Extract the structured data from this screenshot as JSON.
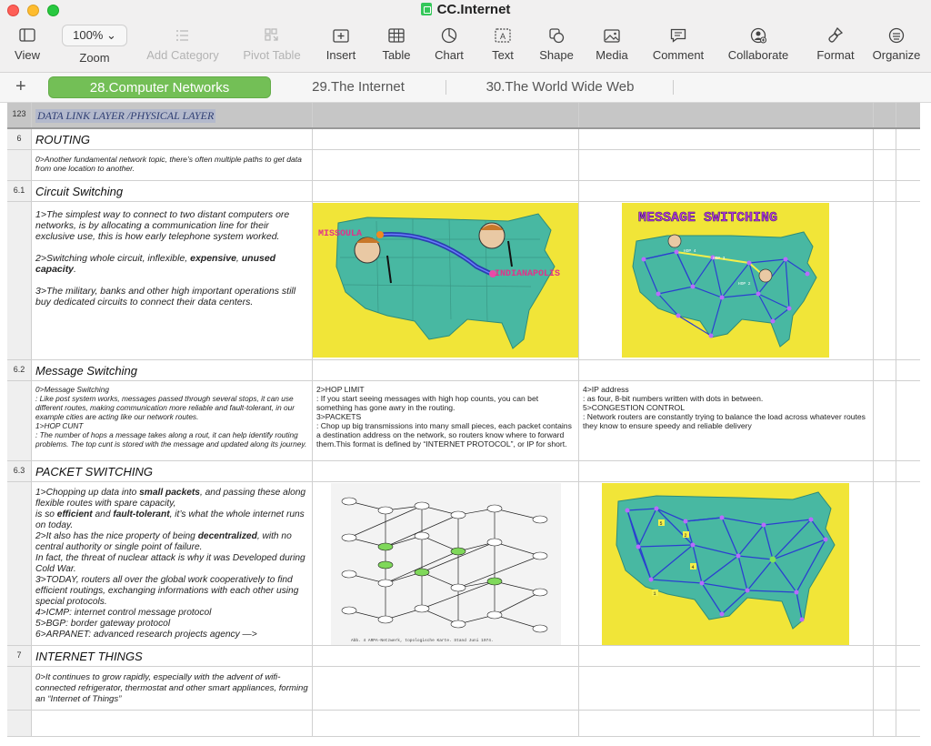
{
  "window": {
    "title": "CC.Internet"
  },
  "toolbar": {
    "view": "View",
    "zoom_value": "100%",
    "zoom": "Zoom",
    "add_category": "Add Category",
    "pivot_table": "Pivot Table",
    "insert": "Insert",
    "table": "Table",
    "chart": "Chart",
    "text": "Text",
    "shape": "Shape",
    "media": "Media",
    "comment": "Comment",
    "collaborate": "Collaborate",
    "format": "Format",
    "organize": "Organize"
  },
  "tabs": [
    {
      "label": "28.Computer Networks",
      "active": true
    },
    {
      "label": "29.The Internet",
      "active": false
    },
    {
      "label": "30.The World Wide Web",
      "active": false
    }
  ],
  "rows": {
    "header": {
      "num": "123",
      "text": "DATA LINK LAYER /PHYSICAL LAYER"
    },
    "routing": {
      "num": "6",
      "text": "ROUTING"
    },
    "routing_body": {
      "text": "0>Another fundamental network topic, there’s often multiple paths to get data from one location to another."
    },
    "circuit": {
      "num": "6.1",
      "text": "Circuit Switching"
    },
    "circuit_body": {
      "p1": "1>The simplest way to connect to two distant computers ore networks, is by allocating a communication line for their exclusive use, this is how early telephone system worked.",
      "p2_pre": "2>Switching whole circuit, inflexible, ",
      "p2_b1": "expensive",
      "p2_mid": ", ",
      "p2_b2": "unused capacity",
      "p2_post": ".",
      "p3": "3>The military, banks and other high important operations still buy dedicated circuits to connect their data centers.",
      "img1_label_a": "MISSOULA",
      "img1_label_b": "INDIANAPOLIS",
      "img2_title": "MESSAGE SWITCHING",
      "img2_hops": [
        "HOP 4",
        "HOP 3",
        "HOP 2"
      ]
    },
    "message": {
      "num": "6.2",
      "text": "Message Switching"
    },
    "message_body": {
      "col1": [
        "0>Message Switching",
        ": Like post system works, messages passed through several stops, it can use different routes, making communication more reliable and fault-tolerant, in our example cities are acting like our network routes.",
        "1>HOP CUNT",
        ": The number of hops a message takes along a rout, it can help identify routing problems. The top cunt is stored with the message and updated along its journey."
      ],
      "col2": [
        "2>HOP LIMIT",
        ": If you start seeing messages with high hop counts, you can bet something has gone awry in the routing.",
        "3>PACKETS",
        ": Chop up big transmissions into many small pieces, each packet contains a destination address on the network, so routers know where to forward them.This format is defined by “INTERNET PROTOCOL”, or IP for short."
      ],
      "col3": [
        "4>IP address",
        ": as four, 8-bit numbers written with dots in between.",
        "5>CONGESTION CONTROL",
        ": Network routers are constantly trying to balance the load across whatever routes they know to ensure speedy and reliable delivery"
      ]
    },
    "packet": {
      "num": "6.3",
      "text": "PACKET SWITCHING"
    },
    "packet_body": {
      "l1_pre": "1>Chopping up data into ",
      "l1_b": "small packets",
      "l1_post": ", and passing these along flexible routes with spare capacity,",
      "l2_pre": "is so ",
      "l2_b1": "efficient",
      "l2_mid": " and ",
      "l2_b2": "fault-tolerant",
      "l2_post": ", it’s what the whole internet runs on today.",
      "l3_pre": "2>It also has the nice property of being ",
      "l3_b": "decentralized",
      "l3_post": ", with no central authority or single point of failure.",
      "l4": "In fact, the threat of nuclear attack is why it was Developed during Cold War.",
      "l5": "3>TODAY, routers all over the global work cooperatively to find efficient routings, exchanging informations with each other using special protocols.",
      "l6": "4>ICMP: internet control message protocol",
      "l7": "5>BGP: border gateway protocol",
      "l8": "6>ARPANET: advanced research projects agency —>",
      "arpanet_caption": "Abb. 4  ARPA-Netzwerk, topologische Karte. Stand Juni 1974.",
      "map_numbers": [
        "5",
        "2",
        "4",
        "1"
      ]
    },
    "internet": {
      "num": "7",
      "text": "INTERNET THINGS"
    },
    "internet_body": {
      "text": "0>It continues to grow rapidly, especially with the advent of wifi-connected refrigerator, thermostat and other smart appliances, forming an “Internet of Things”"
    }
  }
}
